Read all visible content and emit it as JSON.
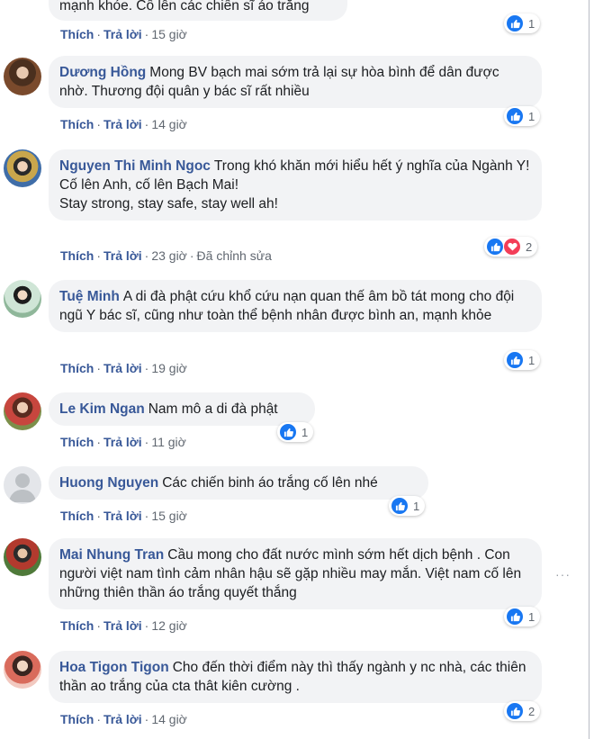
{
  "actions": {
    "like": "Thích",
    "reply": "Trả lời",
    "dot": "·"
  },
  "comments": [
    {
      "author": "",
      "text": "mạnh khỏe. Cố lên các chiến sĩ áo trắng",
      "time": "15 giờ",
      "edited": "",
      "reaction_count": "1",
      "reaction_types": [
        "like"
      ]
    },
    {
      "author": "Dương Hồng",
      "text": "Mong BV bạch mai sớm trả lại sự hòa bình để dân được nhờ. Thương đội quân y bác sĩ rất nhiều",
      "time": "14 giờ",
      "edited": "",
      "reaction_count": "1",
      "reaction_types": [
        "like"
      ]
    },
    {
      "author": "Nguyen Thi Minh Ngoc",
      "text": "Trong khó khăn mới hiểu hết ý nghĩa của Ngành Y!",
      "line2": "Cố lên Anh, cố lên Bạch Mai!",
      "line3": "Stay strong, stay safe, stay well ah!",
      "time": "23 giờ",
      "edited": "Đã chỉnh sửa",
      "reaction_count": "2",
      "reaction_types": [
        "like",
        "love"
      ]
    },
    {
      "author": "Tuệ Minh",
      "text": "A di đà phật cứu khổ cứu nạn quan thế âm bồ tát mong cho đội ngũ Y bác sĩ, cũng như toàn thể bệnh nhân được bình an, mạnh khỏe",
      "time": "19 giờ",
      "edited": "",
      "reaction_count": "1",
      "reaction_types": [
        "like"
      ]
    },
    {
      "author": "Le Kim Ngan",
      "text": "Nam mô a di đà phật",
      "time": "11 giờ",
      "edited": "",
      "reaction_count": "1",
      "reaction_types": [
        "like"
      ]
    },
    {
      "author": "Huong Nguyen",
      "text": "Các chiến binh áo trắng cố lên nhé",
      "time": "15 giờ",
      "edited": "",
      "reaction_count": "1",
      "reaction_types": [
        "like"
      ]
    },
    {
      "author": "Mai Nhung Tran",
      "text": "Cầu mong cho đất nước mình sớm hết dịch bệnh . Con người việt nam tình cảm nhân hậu sẽ gặp nhiều may mắn. Việt nam cố lên những thiên thần áo trắng quyết thắng",
      "time": "12 giờ",
      "edited": "",
      "reaction_count": "1",
      "reaction_types": [
        "like"
      ]
    },
    {
      "author": "Hoa Tigon Tigon",
      "text": "Cho đến thời điểm này thì thấy ngành y nc nhà, các thiên thần ao trắng của cta thât kiên cường .",
      "time": "14 giờ",
      "edited": "",
      "reaction_count": "2",
      "reaction_types": [
        "like"
      ]
    }
  ],
  "colors": {
    "link": "#385898",
    "bubble": "#f2f3f5",
    "like": "#1877f2",
    "love": "#f33e58"
  }
}
